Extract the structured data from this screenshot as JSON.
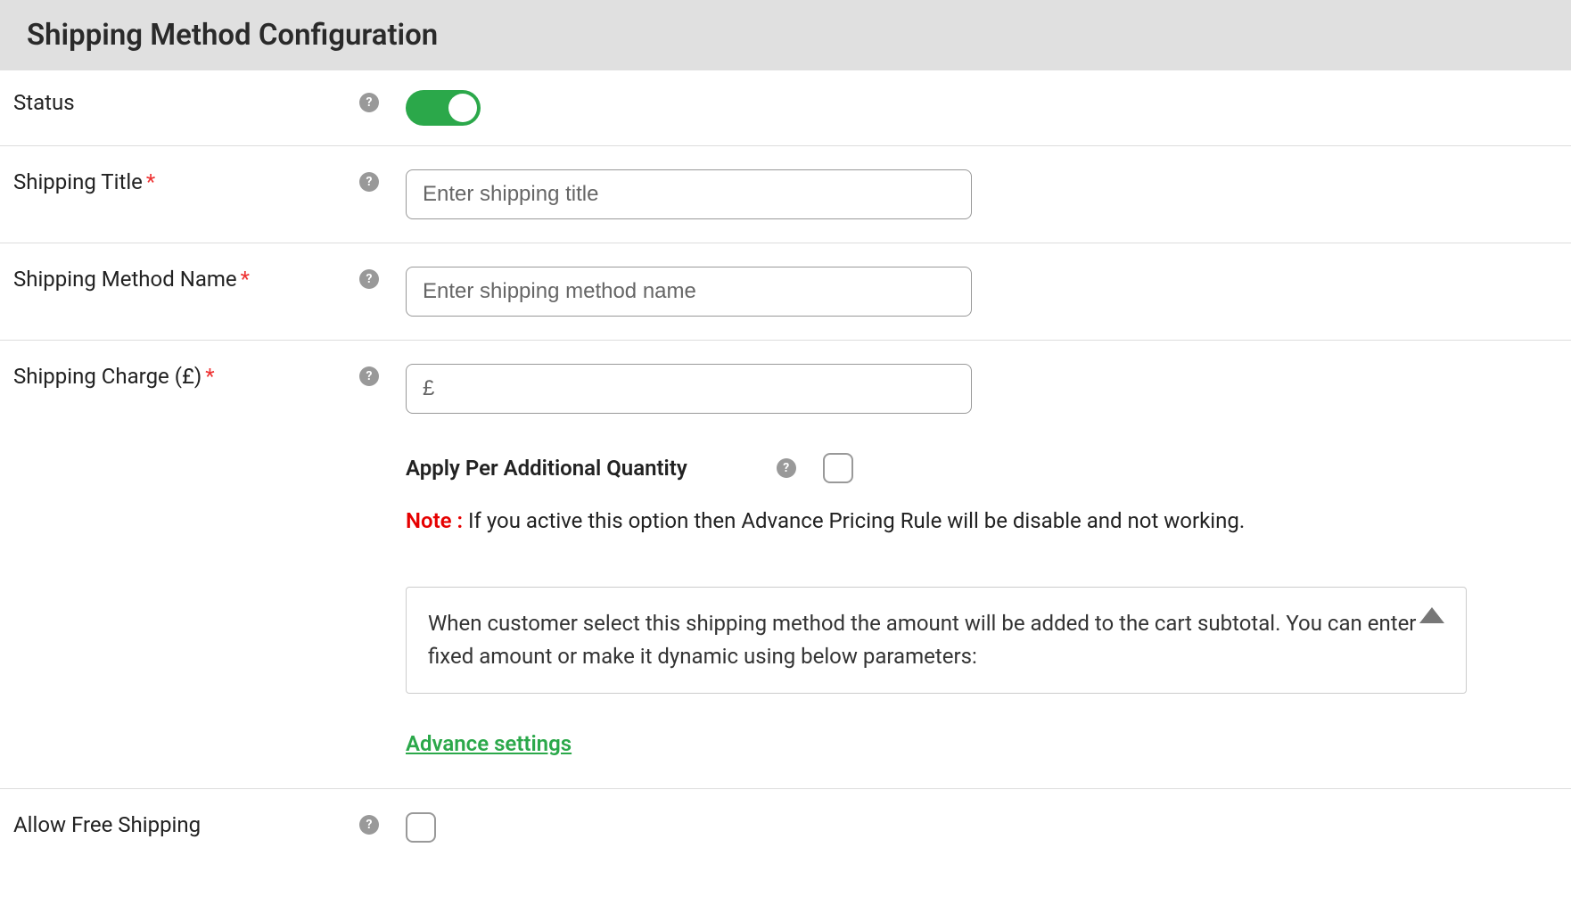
{
  "header": {
    "title": "Shipping Method Configuration"
  },
  "fields": {
    "status": {
      "label": "Status",
      "value": true
    },
    "shipping_title": {
      "label": "Shipping Title",
      "required_mark": "*",
      "placeholder": "Enter shipping title",
      "value": ""
    },
    "shipping_method_name": {
      "label": "Shipping Method Name",
      "required_mark": "*",
      "placeholder": "Enter shipping method name",
      "value": ""
    },
    "shipping_charge": {
      "label": "Shipping Charge (£)",
      "required_mark": "*",
      "placeholder": "£",
      "value": "",
      "apply_per_qty_label": "Apply Per Additional Quantity",
      "note_label": "Note :",
      "note_text": " If you active this option then Advance Pricing Rule will be disable and not working.",
      "info_text": "When customer select this shipping method the amount will be added to the cart subtotal. You can enter fixed amount or make it dynamic using below parameters:",
      "advance_link": "Advance settings"
    },
    "allow_free_shipping": {
      "label": "Allow Free Shipping"
    }
  },
  "help_icon_glyph": "?"
}
